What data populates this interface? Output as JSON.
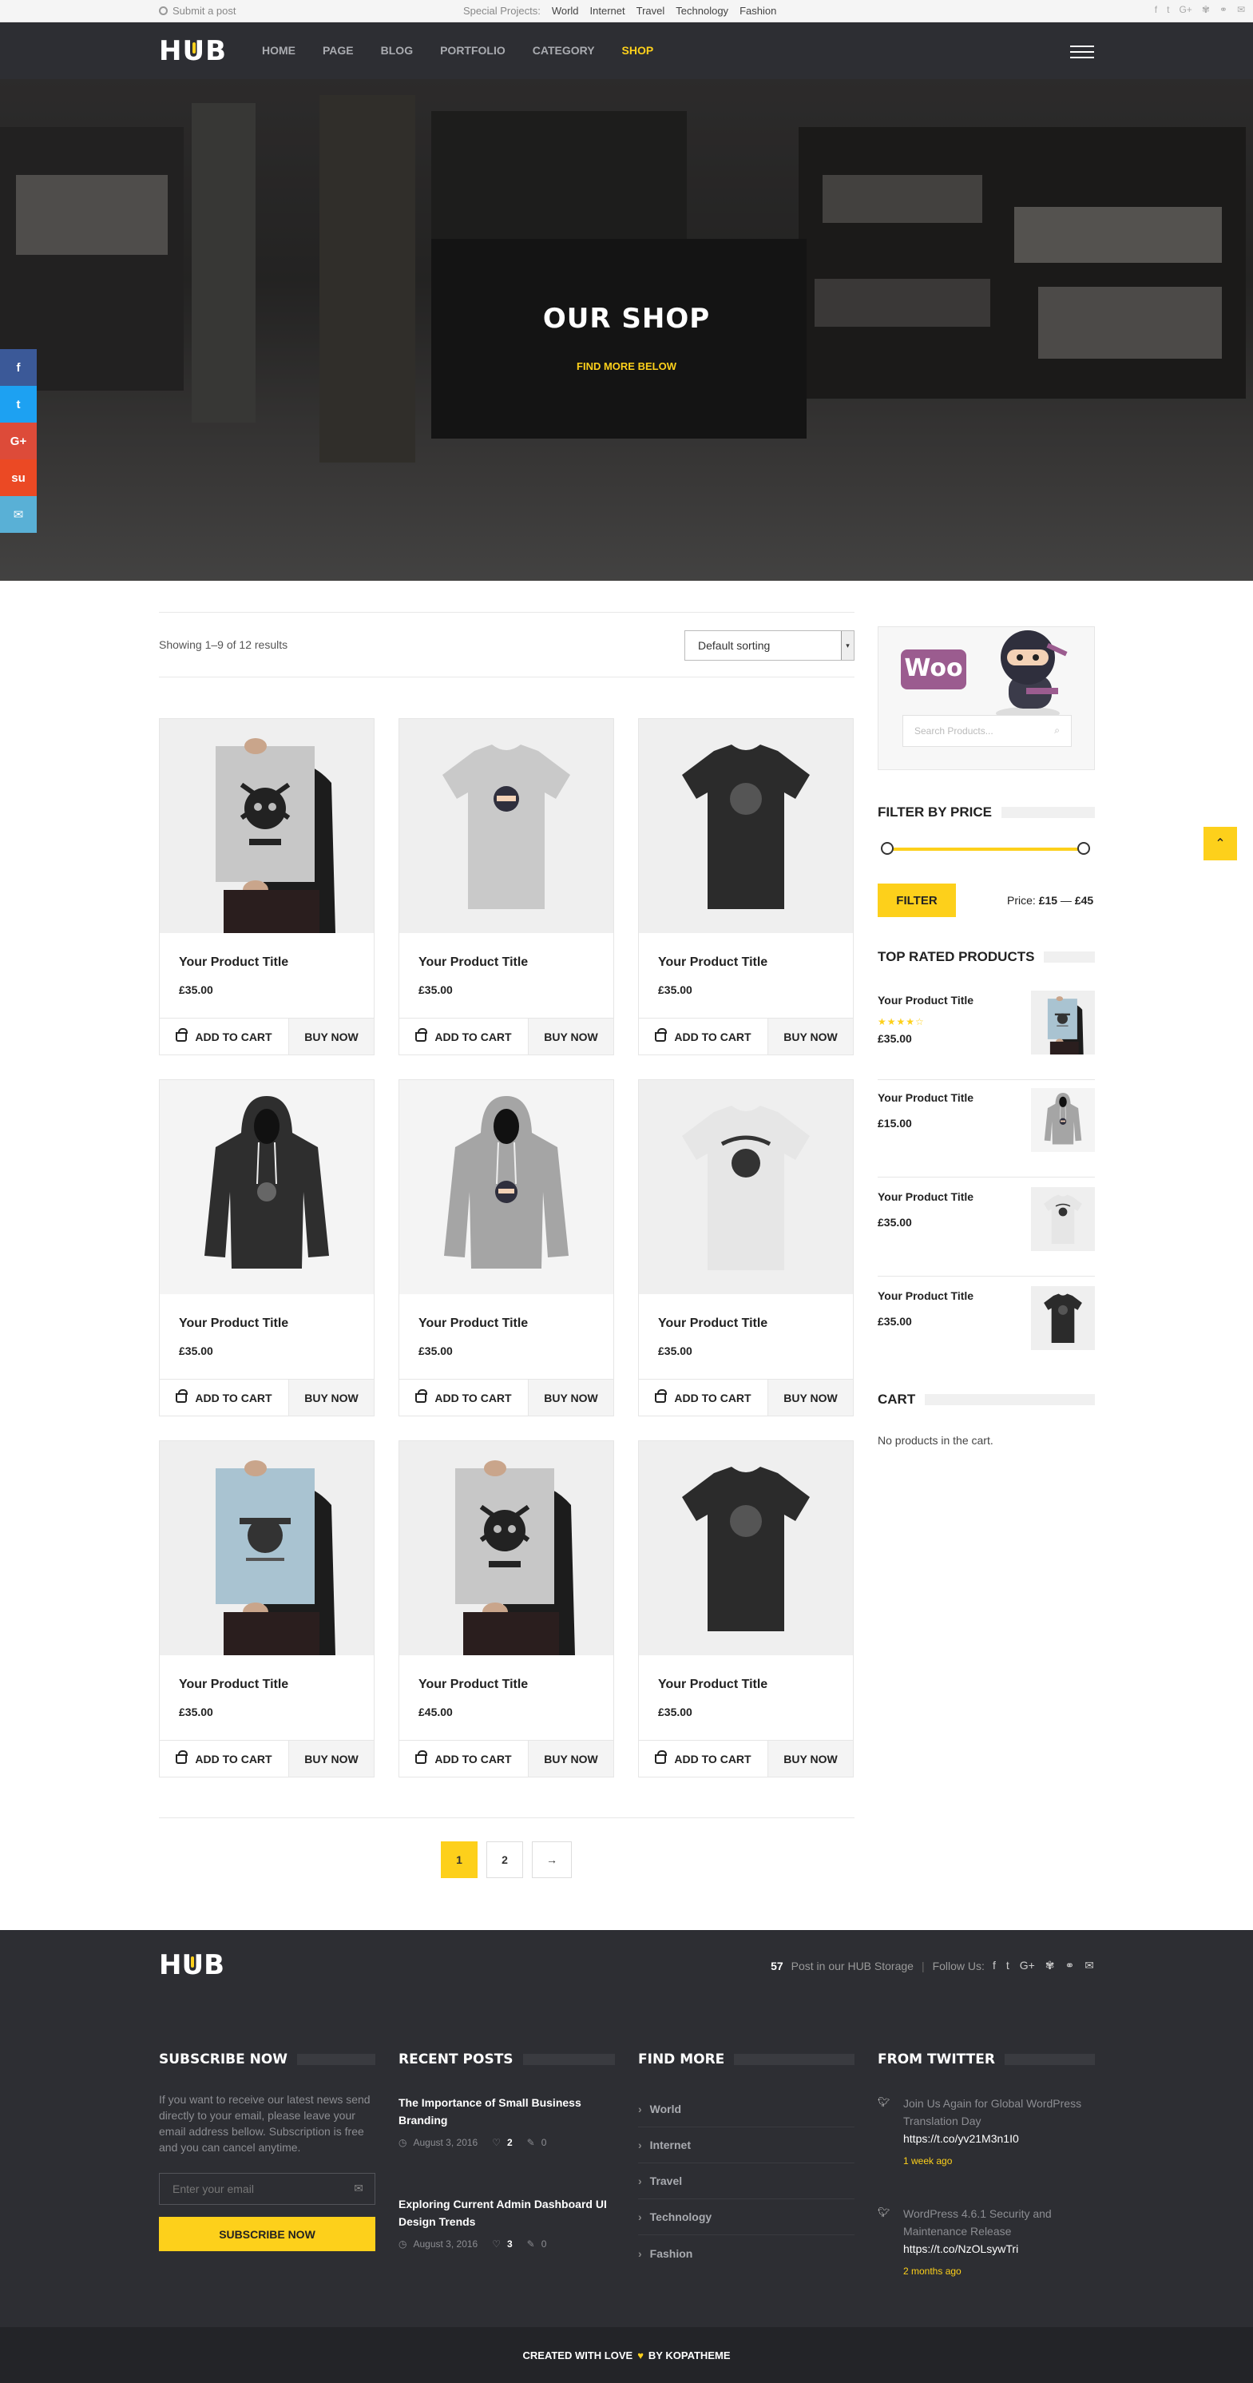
{
  "topbar": {
    "submit": "Submit a post",
    "special_label": "Special Projects:",
    "special_links": [
      "World",
      "Internet",
      "Travel",
      "Technology",
      "Fashion"
    ],
    "social_icons": [
      "facebook-icon",
      "twitter-icon",
      "google-plus-icon",
      "dribbble-icon",
      "link-icon",
      "email-icon"
    ]
  },
  "nav": {
    "logo": "HUB",
    "items": [
      "HOME",
      "PAGE",
      "BLOG",
      "PORTFOLIO",
      "CATEGORY",
      "SHOP"
    ],
    "active": "SHOP"
  },
  "hero": {
    "title": "OUR SHOP",
    "subtitle": "FIND MORE BELOW"
  },
  "side_share": [
    {
      "icon": "facebook-icon",
      "glyph": "f",
      "color": "#3b5998"
    },
    {
      "icon": "twitter-icon",
      "glyph": "t",
      "color": "#1da1f2"
    },
    {
      "icon": "google-plus-icon",
      "glyph": "G+",
      "color": "#dd4b39"
    },
    {
      "icon": "stumbleupon-icon",
      "glyph": "su",
      "color": "#eb4924"
    },
    {
      "icon": "email-icon",
      "glyph": "✉",
      "color": "#59b0d6"
    }
  ],
  "shop": {
    "result_count": "Showing 1–9 of 12 results",
    "sorting": "Default sorting",
    "add_to_cart": "ADD TO CART",
    "buy_now": "BUY NOW",
    "products": [
      {
        "title": "Your Product Title",
        "price": "£35.00",
        "image": "poster-ship-your-idea"
      },
      {
        "title": "Your Product Title",
        "price": "£35.00",
        "image": "tshirt-grey-ninja"
      },
      {
        "title": "Your Product Title",
        "price": "£35.00",
        "image": "tshirt-black"
      },
      {
        "title": "Your Product Title",
        "price": "£35.00",
        "image": "hoodie-black"
      },
      {
        "title": "Your Product Title",
        "price": "£35.00",
        "image": "hoodie-grey-ninja"
      },
      {
        "title": "Your Product Title",
        "price": "£35.00",
        "image": "tshirt-white-woothemes"
      },
      {
        "title": "Your Product Title",
        "price": "£35.00",
        "image": "poster-woothemes"
      },
      {
        "title": "Your Product Title",
        "price": "£45.00",
        "image": "poster-ship-your-idea"
      },
      {
        "title": "Your Product Title",
        "price": "£35.00",
        "image": "tshirt-black"
      }
    ],
    "pagination": [
      "1",
      "2",
      "→"
    ],
    "current_page": "1"
  },
  "sidebar": {
    "woo_logo": "WOO",
    "search_placeholder": "Search Products...",
    "filter_title": "FILTER BY PRICE",
    "filter_button": "FILTER",
    "price_label": "Price:",
    "price_min": "£15",
    "price_max": "£45",
    "top_rated_title": "TOP RATED PRODUCTS",
    "top_rated": [
      {
        "title": "Your Product Title",
        "price": "£35.00",
        "rating": 4,
        "image": "poster-woothemes"
      },
      {
        "title": "Your Product Title",
        "price": "£15.00",
        "image": "hoodie-grey-ninja"
      },
      {
        "title": "Your Product Title",
        "price": "£35.00",
        "image": "tshirt-white-woothemes"
      },
      {
        "title": "Your Product Title",
        "price": "£35.00",
        "image": "tshirt-black"
      }
    ],
    "cart_title": "CART",
    "cart_empty": "No products in the cart."
  },
  "footer": {
    "logo": "HUB",
    "post_count": "57",
    "post_count_label": "Post in our HUB Storage",
    "follow_label": "Follow Us:",
    "subscribe": {
      "title": "SUBSCRIBE NOW",
      "text": "If you want to receive our latest news send directly to your email, please leave your email address bellow. Subscription is free and you can cancel anytime.",
      "placeholder": "Enter your email",
      "button": "SUBSCRIBE NOW"
    },
    "recent_posts": {
      "title": "RECENT POSTS",
      "items": [
        {
          "title": "The Importance of Small Business Branding",
          "date": "August 3, 2016",
          "likes": "2",
          "comments": "0"
        },
        {
          "title": "Exploring Current Admin Dashboard UI Design Trends",
          "date": "August 3, 2016",
          "likes": "3",
          "comments": "0"
        }
      ]
    },
    "find_more": {
      "title": "FIND MORE",
      "items": [
        "World",
        "Internet",
        "Travel",
        "Technology",
        "Fashion"
      ]
    },
    "twitter": {
      "title": "FROM TWITTER",
      "items": [
        {
          "text": "Join Us Again for Global WordPress Translation Day",
          "link": "https://t.co/yv21M3n1I0",
          "time": "1 week ago"
        },
        {
          "text": "WordPress 4.6.1 Security and Maintenance Release",
          "link": "https://t.co/NzOLsywTri",
          "time": "2 months ago"
        }
      ]
    },
    "copyright_left": "CREATED WITH LOVE",
    "copyright_right": "BY KOPATHEME"
  },
  "colors": {
    "accent": "#fdd01b",
    "dark": "#2d2e33",
    "woo_purple": "#9b5c8f"
  }
}
